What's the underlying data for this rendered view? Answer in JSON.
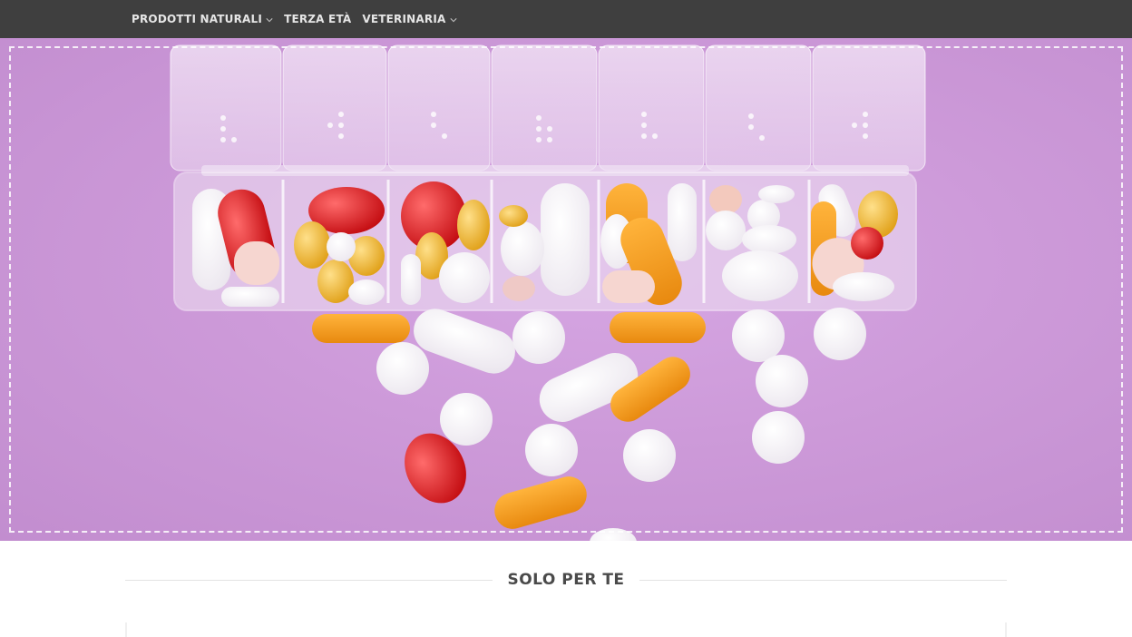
{
  "nav": {
    "items": [
      {
        "label": "PRODOTTI NATURALI",
        "has_dropdown": true
      },
      {
        "label": "TERZA ETÀ",
        "has_dropdown": false
      },
      {
        "label": "VETERINARIA",
        "has_dropdown": true
      }
    ]
  },
  "hero": {
    "image": "weekly-pill-organizer-photo",
    "background_color": "#cd9ad9"
  },
  "section": {
    "title": "SOLO PER TE"
  },
  "colors": {
    "nav_bg": "#3f3f3f",
    "nav_text": "#e6e6e6",
    "title_text": "#4a4a4a"
  }
}
